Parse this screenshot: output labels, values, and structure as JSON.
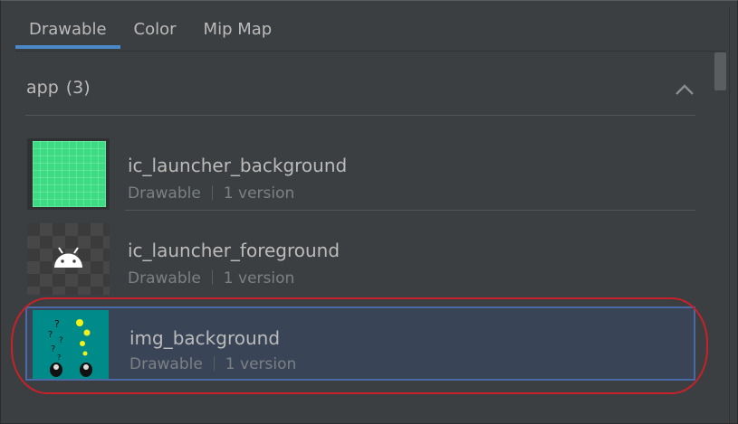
{
  "tabs": [
    {
      "label": "Drawable",
      "active": true
    },
    {
      "label": "Color",
      "active": false
    },
    {
      "label": "Mip Map",
      "active": false
    }
  ],
  "section": {
    "name": "app",
    "count": "(3)",
    "collapse_icon": "chevron-up-icon"
  },
  "resources": [
    {
      "name": "ic_launcher_background",
      "type": "Drawable",
      "versions": "1 version",
      "thumbnail": "green-grid"
    },
    {
      "name": "ic_launcher_foreground",
      "type": "Drawable",
      "versions": "1 version",
      "thumbnail": "android-head-on-checker"
    },
    {
      "name": "img_background",
      "type": "Drawable",
      "versions": "1 version",
      "thumbnail": "teal-illustration",
      "selected": true
    }
  ],
  "colors": {
    "background": "#3c3f41",
    "tab_accent": "#4a88c7",
    "selection_border": "#4a6aa6",
    "highlight_ring": "#c8212a",
    "android_green": "#3ddc84",
    "thumbnail_teal": "#008b8b"
  }
}
